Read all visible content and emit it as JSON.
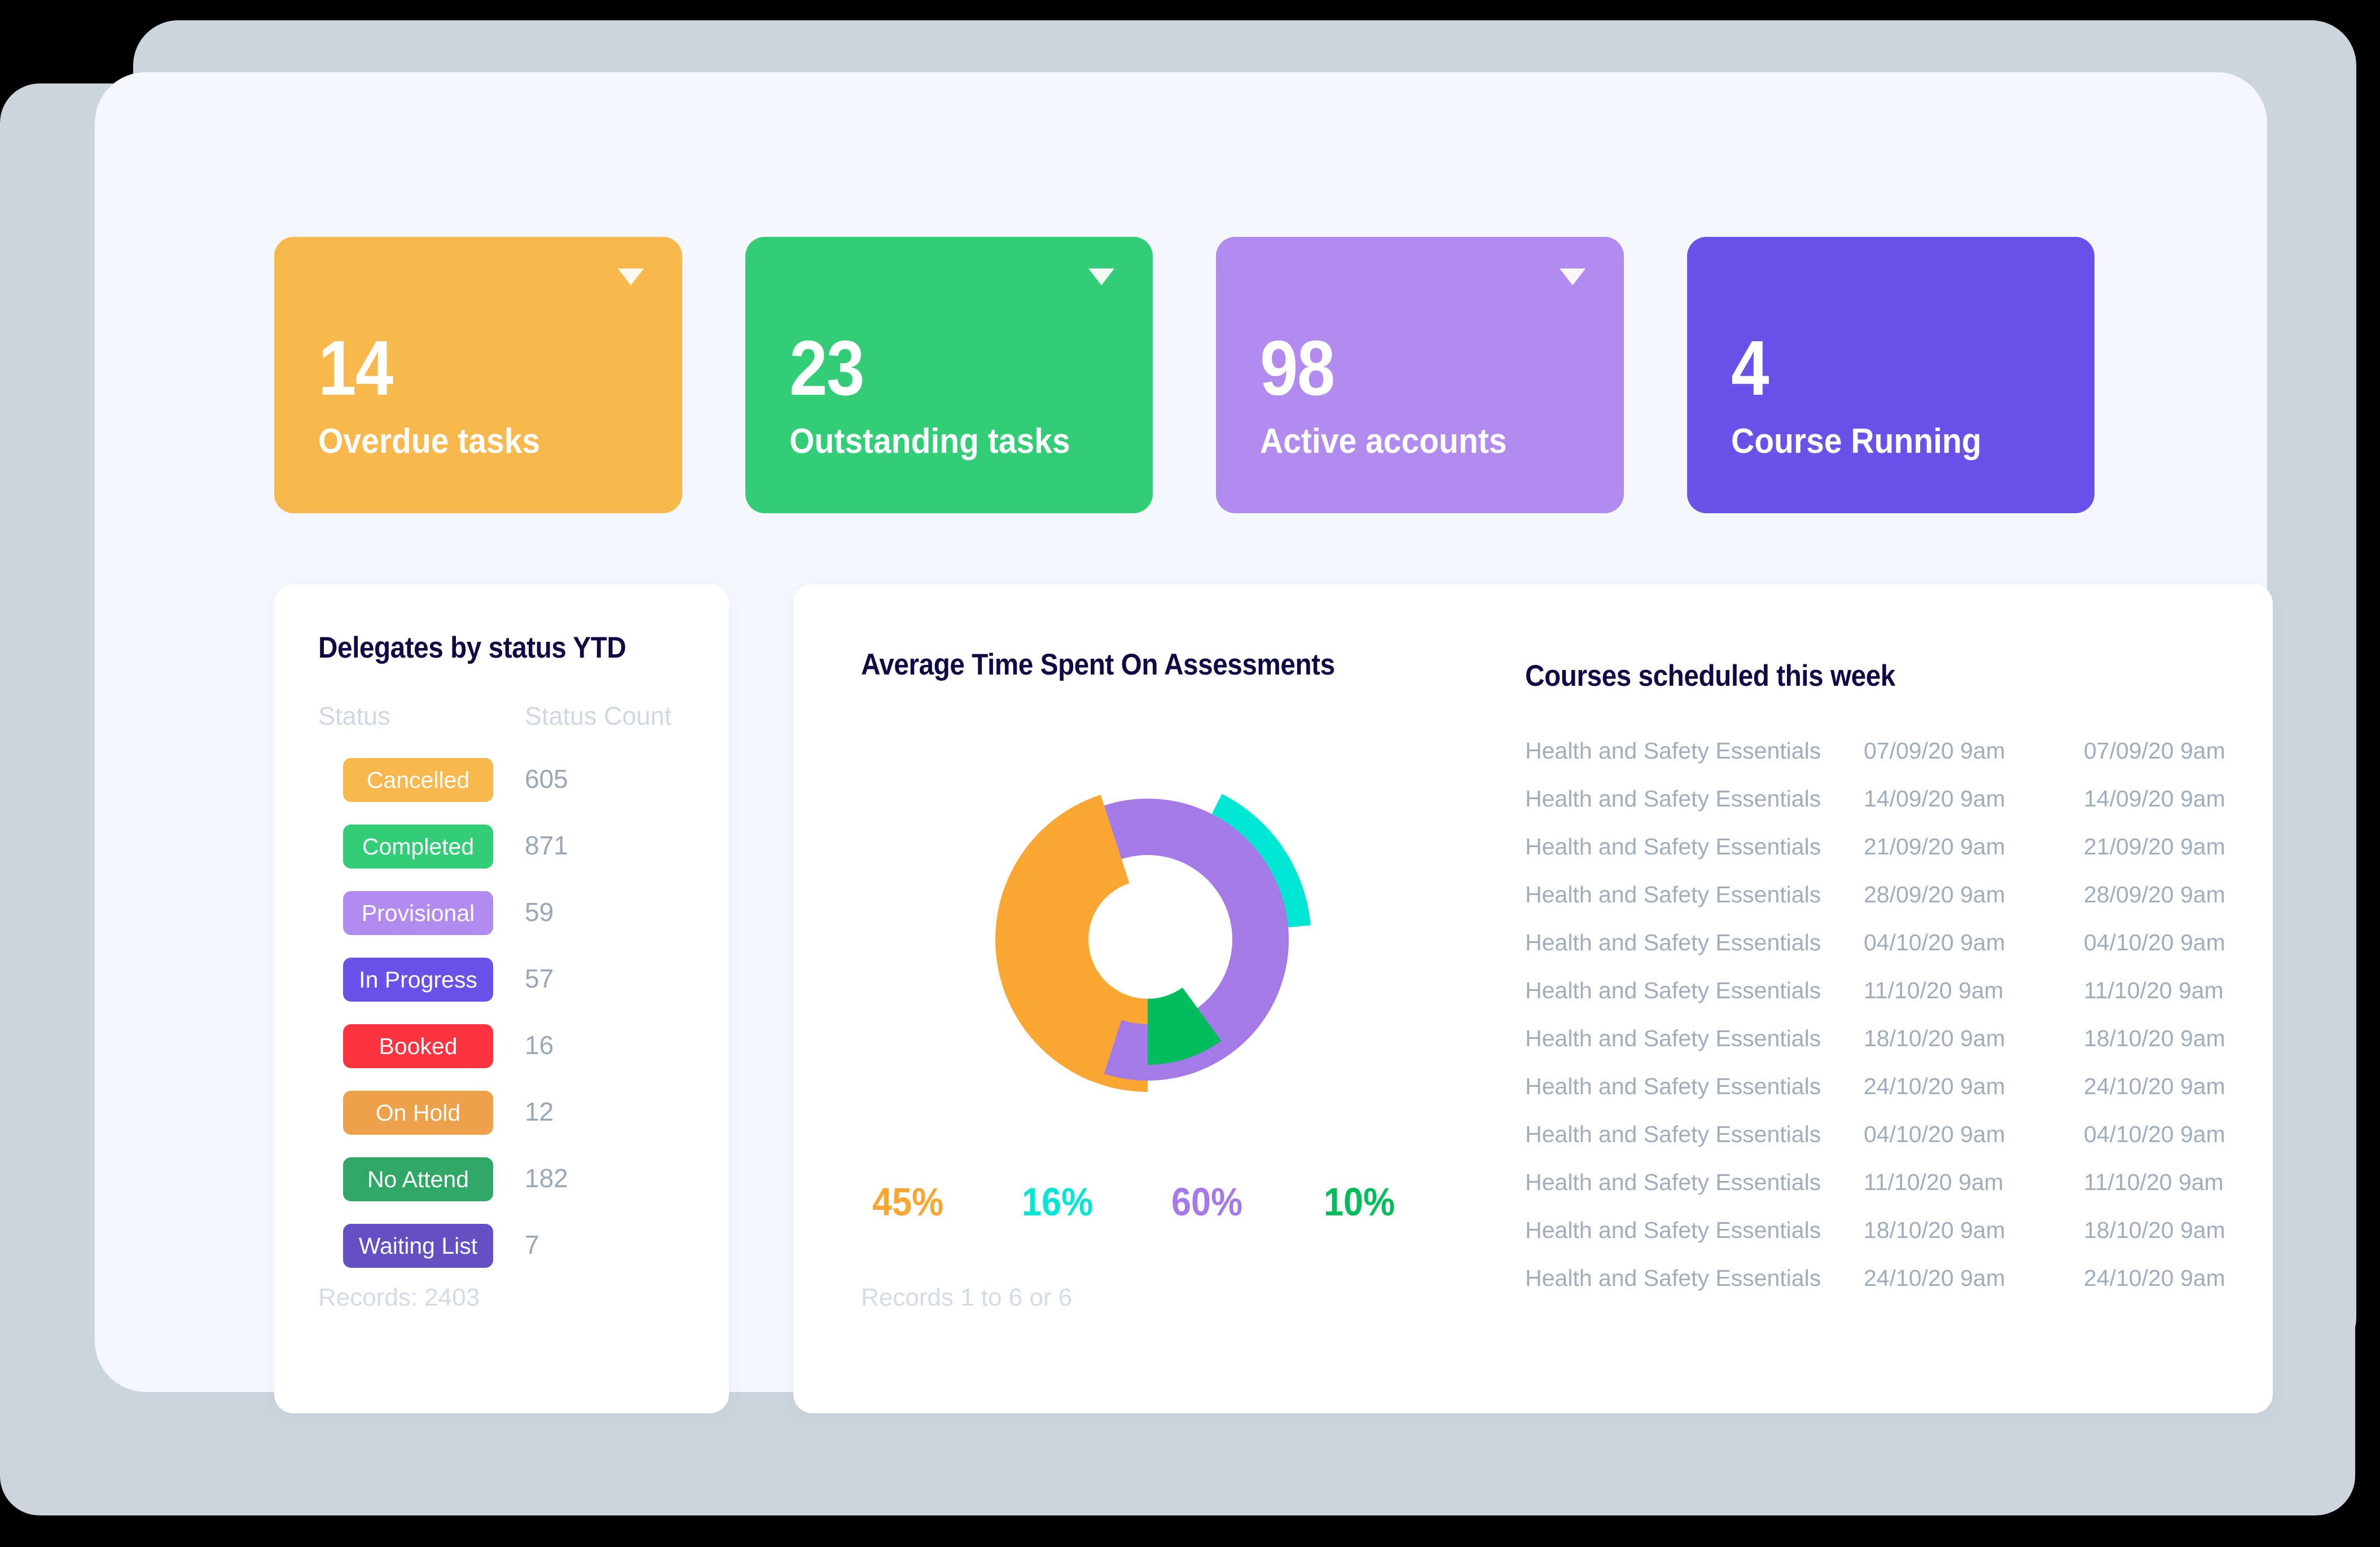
{
  "kpi_cards": [
    {
      "value": "14",
      "label": "Overdue tasks",
      "color": "#f8b84e",
      "has_caret": true,
      "name": "overdue-tasks"
    },
    {
      "value": "23",
      "label": "Outstanding tasks",
      "color": "#33cc77",
      "has_caret": true,
      "name": "outstanding-tasks"
    },
    {
      "value": "98",
      "label": "Active accounts",
      "color": "#b18cee",
      "has_caret": true,
      "name": "active-accounts"
    },
    {
      "value": "4",
      "label": "Course Running",
      "color": "#6a52e8",
      "has_caret": false,
      "name": "course-running"
    }
  ],
  "delegates_panel": {
    "title": "Delegates by status YTD",
    "columns": {
      "status": "Status",
      "count": "Status Count"
    },
    "rows": [
      {
        "label": "Cancelled",
        "count": "605",
        "color": "#f8b84e"
      },
      {
        "label": "Completed",
        "count": "871",
        "color": "#33cc77"
      },
      {
        "label": "Provisional",
        "count": "59",
        "color": "#b18cee"
      },
      {
        "label": "In Progress",
        "count": "57",
        "color": "#6a52e8"
      },
      {
        "label": "Booked",
        "count": "16",
        "color": "#fc3440"
      },
      {
        "label": "On Hold",
        "count": "12",
        "color": "#eda14a"
      },
      {
        "label": "No Attend",
        "count": "182",
        "color": "#2fa866"
      },
      {
        "label": "Waiting List",
        "count": "7",
        "color": "#6450c4"
      }
    ],
    "records_footer": "Records: 2403"
  },
  "assessments_panel": {
    "title": "Average Time Spent On Assessments",
    "records_footer": "Records 1 to 6 or 6"
  },
  "courses_panel": {
    "title": "Courses scheduled this week",
    "rows": [
      {
        "name": "Health and Safety Essentials",
        "date_start": "07/09/20  9am",
        "date_end": "07/09/20  9am"
      },
      {
        "name": "Health and Safety Essentials",
        "date_start": "14/09/20  9am",
        "date_end": "14/09/20  9am"
      },
      {
        "name": "Health and Safety Essentials",
        "date_start": "21/09/20  9am",
        "date_end": "21/09/20  9am"
      },
      {
        "name": "Health and Safety Essentials",
        "date_start": "28/09/20  9am",
        "date_end": "28/09/20  9am"
      },
      {
        "name": "Health and Safety Essentials",
        "date_start": "04/10/20  9am",
        "date_end": "04/10/20  9am"
      },
      {
        "name": "Health and Safety Essentials",
        "date_start": "11/10/20  9am",
        "date_end": "11/10/20  9am"
      },
      {
        "name": "Health and Safety Essentials",
        "date_start": "18/10/20  9am",
        "date_end": "18/10/20  9am"
      },
      {
        "name": "Health and Safety Essentials",
        "date_start": "24/10/20  9am",
        "date_end": "24/10/20  9am"
      },
      {
        "name": "Health and Safety Essentials",
        "date_start": "04/10/20  9am",
        "date_end": "04/10/20  9am"
      },
      {
        "name": "Health and Safety Essentials",
        "date_start": "11/10/20  9am",
        "date_end": "11/10/20  9am"
      },
      {
        "name": "Health and Safety Essentials",
        "date_start": "18/10/20  9am",
        "date_end": "18/10/20  9am"
      },
      {
        "name": "Health and Safety Essentials",
        "date_start": "24/10/20  9am",
        "date_end": "24/10/20  9am"
      }
    ]
  },
  "chart_data": {
    "type": "pie",
    "title": "Average Time Spent On Assessments",
    "variant": "nested-donut",
    "categories": [
      "Orange segment",
      "Cyan segment",
      "Purple segment",
      "Green segment"
    ],
    "values": [
      45,
      16,
      60,
      10
    ],
    "labels": [
      "45%",
      "16%",
      "60%",
      "10%"
    ],
    "colors": [
      "#faa632",
      "#00e6d2",
      "#a57ae8",
      "#00bc5c"
    ],
    "segments": [
      {
        "label": "45%",
        "value": 45,
        "color": "#faa632",
        "start_angle_deg": 180,
        "end_angle_deg": 342,
        "inner_radius": 105,
        "outer_radius": 270
      },
      {
        "label": "16%",
        "value": 16,
        "color": "#00e6d2",
        "start_angle_deg": 27,
        "end_angle_deg": 85,
        "inner_radius": 232,
        "outer_radius": 290
      },
      {
        "label": "60%",
        "value": 60,
        "color": "#a57ae8",
        "start_angle_deg": 342,
        "end_angle_deg": 558,
        "inner_radius": 150,
        "outer_radius": 250
      },
      {
        "label": "10%",
        "value": 10,
        "color": "#00bc5c",
        "start_angle_deg": 144,
        "end_angle_deg": 180,
        "inner_radius": 105,
        "outer_radius": 222
      }
    ],
    "legend_position": "bottom",
    "grid": false
  }
}
